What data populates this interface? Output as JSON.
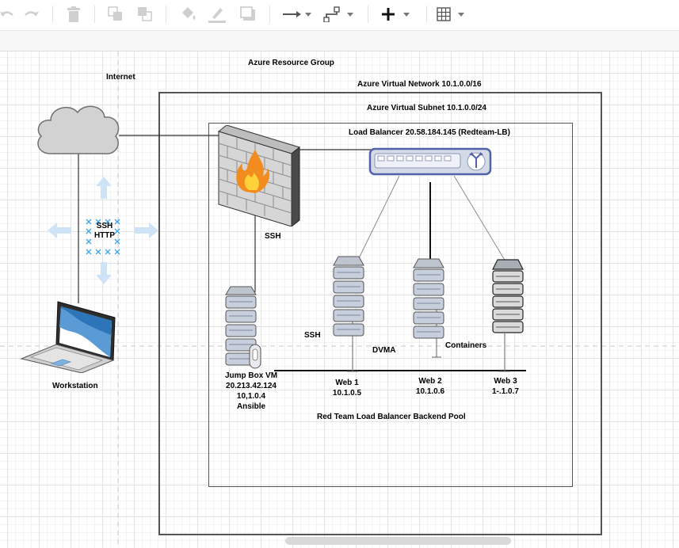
{
  "toolbar": {
    "icons": [
      "undo-icon",
      "redo-icon",
      "delete-icon",
      "to-front-icon",
      "to-back-icon",
      "fill-color-icon",
      "line-color-icon",
      "shadow-icon",
      "connection-icon",
      "waypoints-icon",
      "insert-icon",
      "table-icon"
    ]
  },
  "colors": {
    "grid": "#e4e4e4",
    "border": "#555555",
    "server": "#c7cfdc",
    "lb": "#d5dae7",
    "lb_border": "#5062a8",
    "cloud": "#d2d2d2",
    "arrow": "#cfe3f7",
    "cross": "#3aa6e8"
  },
  "diagram": {
    "labels": {
      "resource_group": "Azure Resource Group",
      "internet": "Internet",
      "vnet": "Azure Virtual Network 10.1.0.0/16",
      "subnet": "Azure Virtual Subnet 10.1.0.0/24",
      "load_balancer": "Load Balancer 20.58.184.145 (Redteam-LB)",
      "ssh_http_1": "SSH",
      "ssh_http_2": "HTTP",
      "ssh_firewall": "SSH",
      "ssh_jumpbox": "SSH",
      "dvma": "DVMA",
      "containers": "Containers",
      "workstation": "Workstation",
      "jumpbox_1": "Jump Box VM",
      "jumpbox_2": "20.213.42.124",
      "jumpbox_3": "10,1.0.4",
      "jumpbox_4": "Ansible",
      "web1_name": "Web 1",
      "web1_ip": "10.1.0.5",
      "web2_name": "Web 2",
      "web2_ip": "10.1.0.6",
      "web3_name": "Web 3",
      "web3_ip": "1-.1.0.7",
      "backend_pool": "Red Team Load Balancer Backend Pool"
    }
  }
}
